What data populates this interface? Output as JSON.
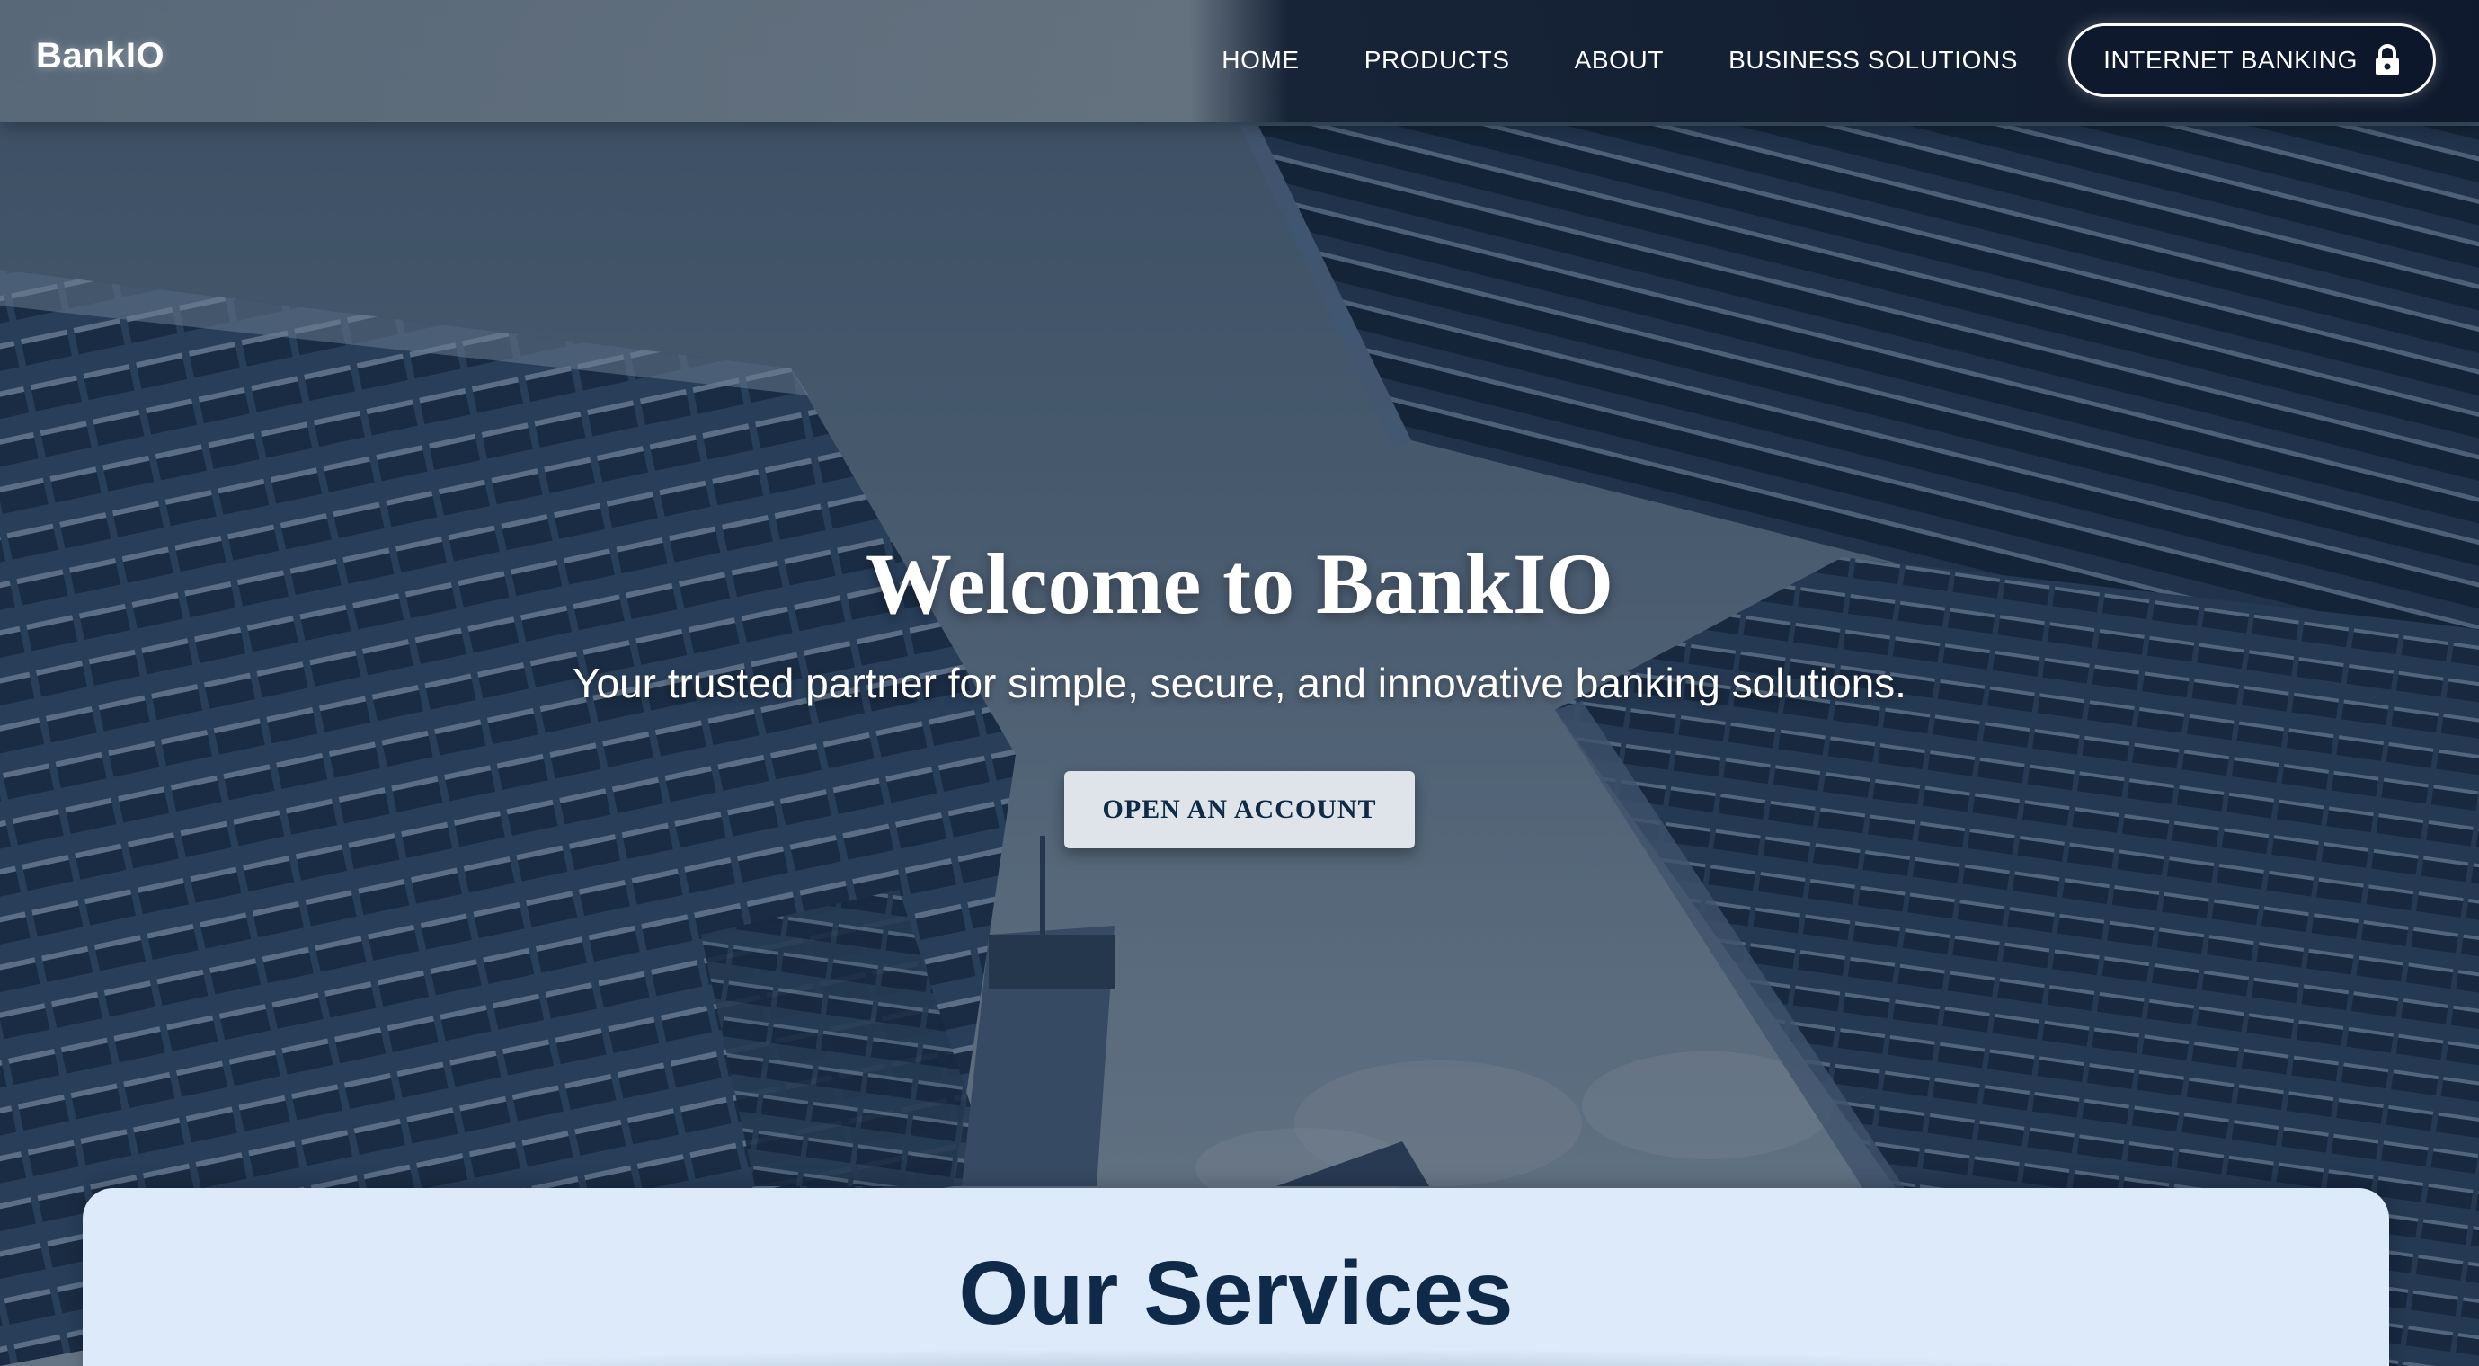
{
  "brand": {
    "name": "BankIO"
  },
  "nav": {
    "items": [
      {
        "label": "HOME"
      },
      {
        "label": "PRODUCTS"
      },
      {
        "label": "ABOUT"
      },
      {
        "label": "BUSINESS SOLUTIONS"
      }
    ],
    "internet_banking": {
      "label": "INTERNET BANKING",
      "icon": "lock-icon"
    }
  },
  "hero": {
    "title": "Welcome to BankIO",
    "subtitle": "Your trusted partner for simple, secure, and innovative banking solutions.",
    "cta_label": "OPEN AN ACCOUNT"
  },
  "services": {
    "title": "Our Services"
  },
  "colors": {
    "primary_navy": "#0f2a48",
    "card_background": "#dceafa",
    "cta_background": "#dfe4ea",
    "text_light": "#ffffff"
  }
}
